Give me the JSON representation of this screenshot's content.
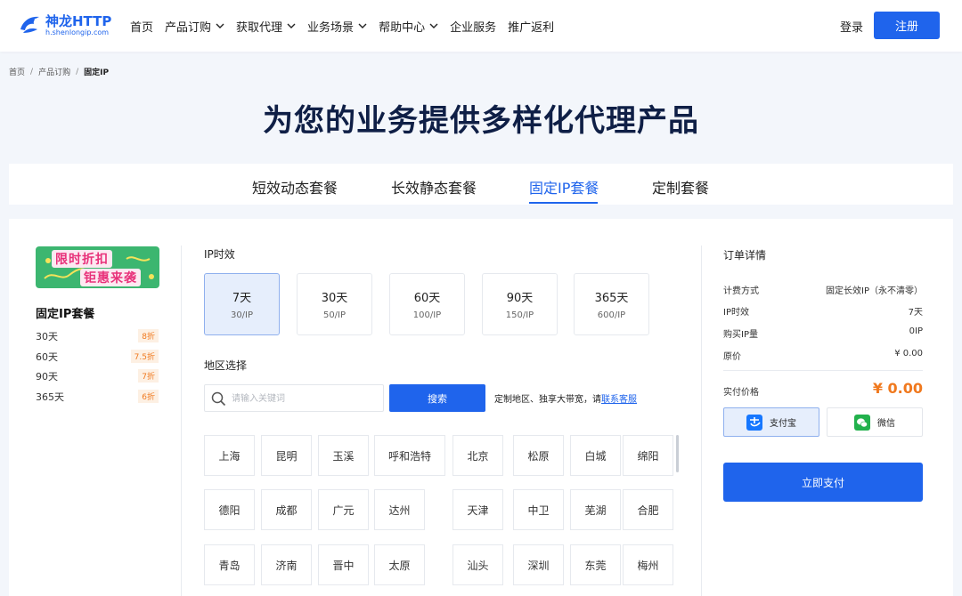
{
  "header": {
    "logo_name": "神龙HTTP",
    "logo_sub": "h.shenlongip.com",
    "nav": [
      {
        "label": "首页",
        "dropdown": false
      },
      {
        "label": "产品订购",
        "dropdown": true
      },
      {
        "label": "获取代理",
        "dropdown": true
      },
      {
        "label": "业务场景",
        "dropdown": true
      },
      {
        "label": "帮助中心",
        "dropdown": true
      },
      {
        "label": "企业服务",
        "dropdown": false
      },
      {
        "label": "推广返利",
        "dropdown": false
      }
    ],
    "login": "登录",
    "register": "注册"
  },
  "breadcrumb": [
    "首页",
    "产品订购",
    "固定IP"
  ],
  "breadcrumb_sep": "/",
  "page_title": "为您的业务提供多样化代理产品",
  "tabs": [
    "短效动态套餐",
    "长效静态套餐",
    "固定IP套餐",
    "定制套餐"
  ],
  "active_tab": 2,
  "promo": {
    "line1": "限时折扣",
    "line2": "钜惠来袭"
  },
  "package": {
    "title": "固定IP套餐",
    "items": [
      {
        "duration": "30天",
        "discount": "8折"
      },
      {
        "duration": "60天",
        "discount": "7.5折"
      },
      {
        "duration": "90天",
        "discount": "7折"
      },
      {
        "duration": "365天",
        "discount": "6折"
      }
    ]
  },
  "ip_duration": {
    "label": "IP时效",
    "options": [
      {
        "days": "7天",
        "price": "30/IP"
      },
      {
        "days": "30天",
        "price": "50/IP"
      },
      {
        "days": "60天",
        "price": "100/IP"
      },
      {
        "days": "90天",
        "price": "150/IP"
      },
      {
        "days": "365天",
        "price": "600/IP"
      }
    ],
    "selected": 0
  },
  "region": {
    "label": "地区选择",
    "search_placeholder": "请输入关键词",
    "search_value": "",
    "search_button": "搜索",
    "custom_text": "定制地区、独享大带宽，请",
    "custom_link": "联系客服",
    "cities": [
      "上海",
      "昆明",
      "玉溪",
      "呼和浩特",
      "北京",
      "松原",
      "白城",
      "绵阳",
      "德阳",
      "成都",
      "广元",
      "达州",
      "天津",
      "中卫",
      "芜湖",
      "合肥",
      "青岛",
      "济南",
      "晋中",
      "太原",
      "汕头",
      "深圳",
      "东莞",
      "梅州"
    ]
  },
  "order": {
    "title": "订单详情",
    "rows": [
      {
        "key": "计费方式",
        "value": "固定长效IP（永不清零）"
      },
      {
        "key": "IP时效",
        "value": "7天"
      },
      {
        "key": "购买IP量",
        "value": "0IP"
      },
      {
        "key": "原价",
        "value": "¥ 0.00"
      }
    ],
    "pay_label": "实付价格",
    "pay_price": "¥ 0.00",
    "methods": [
      "支付宝",
      "微信"
    ],
    "pay_now": "立即支付"
  },
  "colors": {
    "primary": "#1f64ec",
    "accent": "#f0791e",
    "title": "#0f1f46",
    "promo_green": "#3cb670",
    "promo_pink": "#e8317a"
  }
}
